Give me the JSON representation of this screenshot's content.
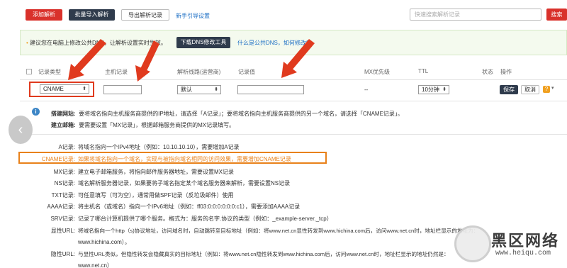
{
  "toolbar": {
    "add_label": "添加解析",
    "batch_import_label": "批量导入解析",
    "export_label": "导出解析记录",
    "guide_label": "新手引导设置",
    "search_placeholder": "快速搜索解析记录",
    "search_button": "搜索"
  },
  "notice": {
    "text": "建议您在电脑上修改公共DNS，让解析设置实时生效。",
    "download_button": "下载DNS修改工具",
    "link": "什么是公共DNS，如何修改?"
  },
  "table_headers": [
    "记录类型",
    "主机记录",
    "解析线路(运营商)",
    "记录值",
    "MX优先级",
    "TTL",
    "状态",
    "操作"
  ],
  "edit_row": {
    "record_type": "CNAME",
    "line": "默认",
    "mx_priority": "--",
    "ttl": "10分钟",
    "save_label": "保存",
    "cancel_label": "取消"
  },
  "help": {
    "website_label": "搭建网站:",
    "website_text": "要将域名指向主机服务商提供的IP地址，请选择「A记录」；要将域名指向主机服务商提供的另一个域名，请选择「CNAME记录」。",
    "mail_label": "建立邮箱:",
    "mail_text": "要需要设置「MX记录」，根据邮箱服务商提供的MX记录填写。"
  },
  "record_types": [
    {
      "label": "A记录:",
      "desc": "将域名指向一个IPv4地址（例如：10.10.10.10），需要增加A记录"
    },
    {
      "label": "CNAME记录:",
      "desc": "如果将域名指向一个域名，实现与被指向域名相同的访问效果，需要增加CNAME记录"
    },
    {
      "label": "MX记录:",
      "desc": "建立电子邮箱服务，将指向邮件服务器地址，需要设置MX记录"
    },
    {
      "label": "NS记录:",
      "desc": "域名解析服务器记录，如果要将子域名指定某个域名服务器来解析，需要设置NS记录"
    },
    {
      "label": "TXT记录:",
      "desc": "可任意填写（可为空），通常用做SPF记录（反垃圾邮件）使用"
    },
    {
      "label": "AAAA记录:",
      "desc": "将主机名（或域名）指向一个IPv6地址（例如：ff03:0:0:0:0:0:0:c1），需要添加AAAA记录"
    },
    {
      "label": "SRV记录:",
      "desc": "记录了哪台计算机提供了哪个服务。格式为：服务的名字.协议的类型（例如：_example-server._tcp）"
    },
    {
      "label": "显性URL:",
      "desc": "将域名指向一个http（s)协议地址，访问域名时，自动跳转至目标地址（例如：将www.net.cn显性转发到www.hichina.com后，访问www.net.cn时，地址栏显示的地址为："
    },
    {
      "label": "",
      "desc": "www.hichina.com）。"
    },
    {
      "label": "隐性URL:",
      "desc": "与显性URL类似，但隐性转发会隐藏真实的目标地址（例如：将www.net.cn隐性转发到www.hichina.com后，访问www.net.cn时，地址栏显示的地址仍然是："
    },
    {
      "label": "",
      "desc": "www.net.cn）"
    }
  ],
  "watermark": {
    "text": "黑区网络",
    "url": "www.heiqu.com"
  },
  "colors": {
    "accent_red": "#d9312b",
    "dark_button": "#2f3b4c",
    "link_blue": "#1a6dc4",
    "highlight_orange": "#e8811a",
    "arrow_red": "#e03a1e"
  }
}
